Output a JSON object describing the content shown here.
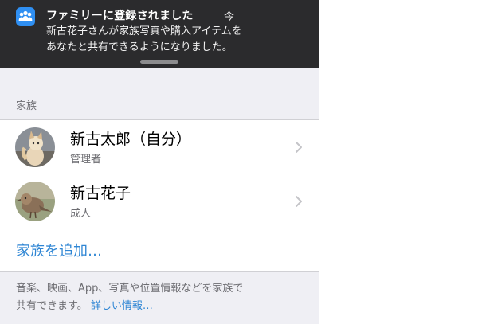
{
  "notification": {
    "title": "ファミリーに登録されました",
    "time": "今",
    "body_line1": "新古花子さんが家族写真や購入アイテムを",
    "body_line2": "あなたと共有できるようになりました。",
    "icon": "family-sharing-icon",
    "icon_color": "#2f8ff2"
  },
  "section_header": "家族",
  "members": [
    {
      "name": "新古太郎（自分）",
      "role": "管理者",
      "avatar": "fox-photo-avatar"
    },
    {
      "name": "新古花子",
      "role": "成人",
      "avatar": "bird-photo-avatar"
    }
  ],
  "add_family_label": "家族を追加…",
  "footer": {
    "line1": "音楽、映画、App、写真や位置情報などを家族で",
    "line2_prefix": "共有できます。",
    "link": "詳しい情報…"
  },
  "colors": {
    "accent": "#2f86d4",
    "banner_bg": "#2b2b2d",
    "grouped_bg": "#efeff4",
    "secondary_text": "#6d6d72"
  }
}
